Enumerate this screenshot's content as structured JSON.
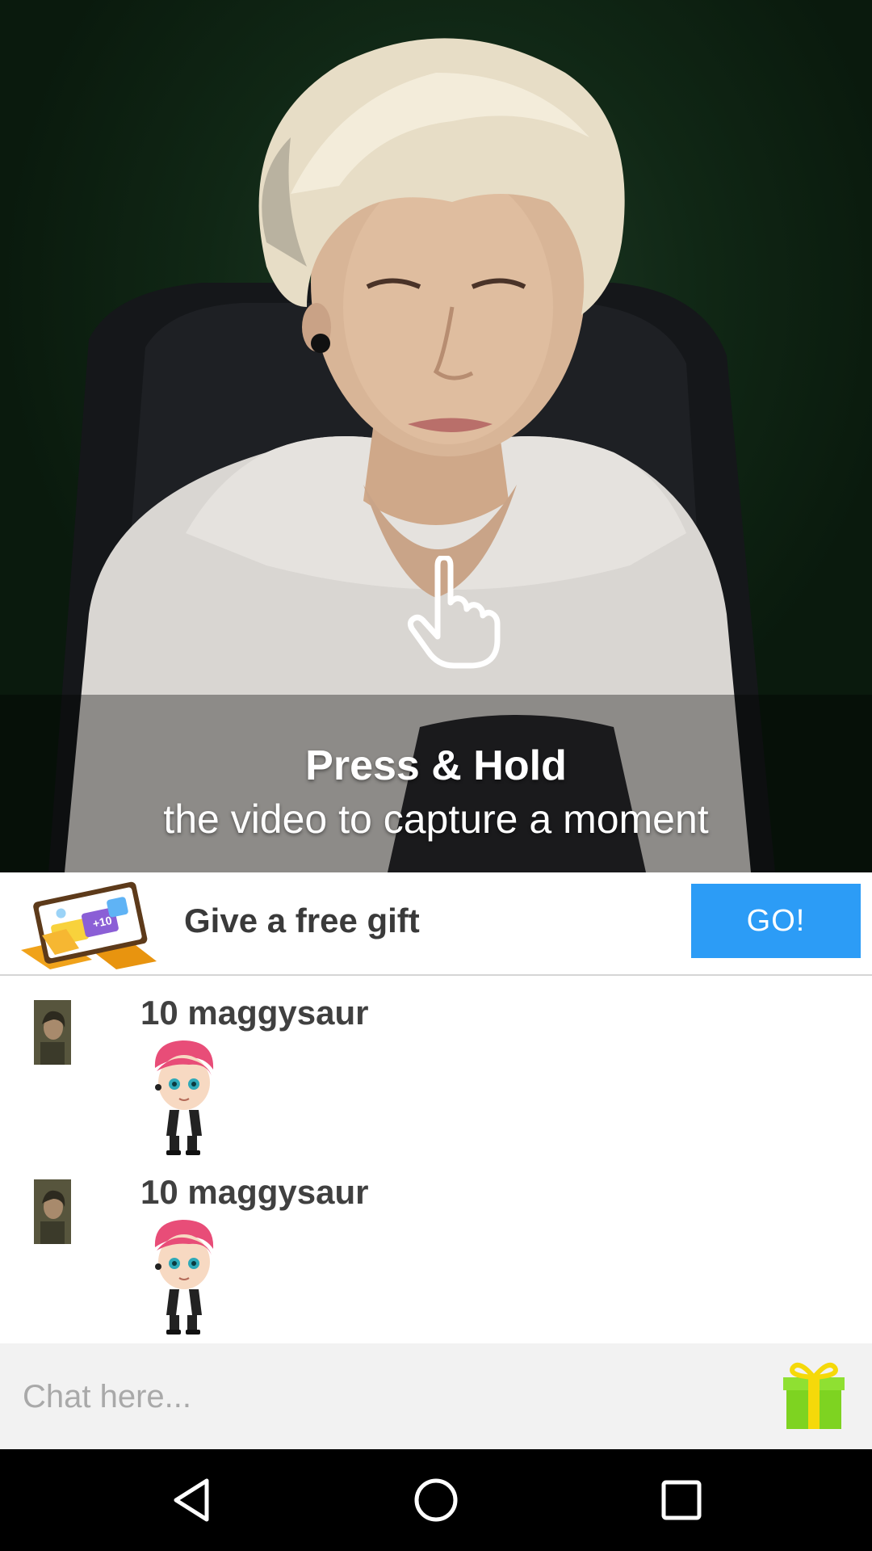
{
  "video": {
    "overlay_icon": "pointing-hand-icon",
    "title": "Press & Hold",
    "subtitle": "the video to capture a moment"
  },
  "gift_banner": {
    "art_icon": "gift-ticket-art",
    "text": "Give a free gift",
    "button_label": "GO!"
  },
  "messages": [
    {
      "avatar": "user-avatar",
      "text": "10 maggysaur",
      "sticker": "pink-hair-avatar-sticker"
    },
    {
      "avatar": "user-avatar",
      "text": "10 maggysaur",
      "sticker": "pink-hair-avatar-sticker"
    }
  ],
  "chat": {
    "placeholder": "Chat here...",
    "gift_icon": "gift-box-icon"
  },
  "nav": {
    "back_icon": "back-triangle-icon",
    "home_icon": "home-circle-icon",
    "recents_icon": "recents-square-icon"
  },
  "colors": {
    "accent": "#2c9cf6",
    "gift_green": "#7ed321",
    "gift_ribbon": "#f5d90a"
  }
}
